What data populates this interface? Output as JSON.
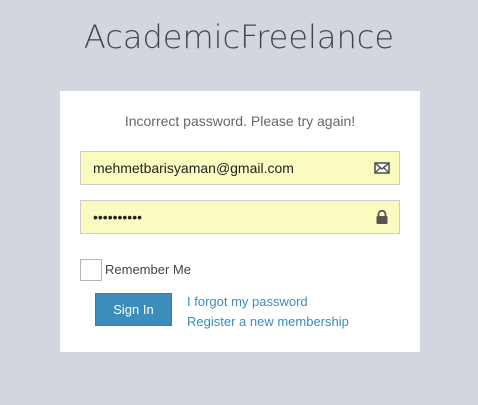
{
  "app": {
    "title": "AcademicFreelance"
  },
  "login": {
    "error_message": "Incorrect password. Please try again!",
    "email": {
      "value": "mehmetbarisyaman@gmail.com",
      "icon": "envelope-icon"
    },
    "password": {
      "value": "••••••••••",
      "icon": "lock-icon"
    },
    "remember_label": "Remember Me",
    "remember_checked": false,
    "signin_label": "Sign In",
    "forgot_link": "I forgot my password",
    "register_link": "Register a new membership"
  },
  "colors": {
    "background": "#d2d6de",
    "input_autofill": "#fafcbf",
    "accent": "#3c8dbc"
  }
}
